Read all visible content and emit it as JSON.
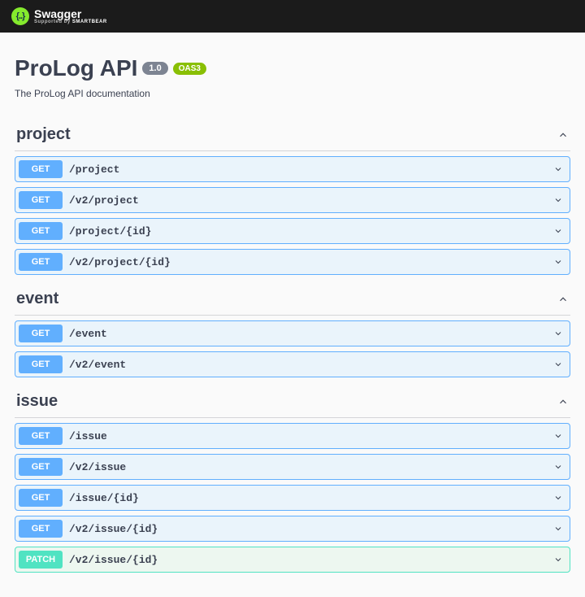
{
  "topbar": {
    "brand": "Swagger",
    "supported_prefix": "Supported by",
    "supported_name": "SMARTBEAR",
    "logo_glyph": "{..}"
  },
  "info": {
    "title": "ProLog API",
    "version": "1.0",
    "oas_badge": "OAS3",
    "description": "The ProLog API documentation"
  },
  "colors": {
    "get": "#61affe",
    "patch": "#50e3c2",
    "oas": "#89bf04"
  },
  "tags": [
    {
      "name": "project",
      "operations": [
        {
          "method": "GET",
          "method_class": "get",
          "path": "/project"
        },
        {
          "method": "GET",
          "method_class": "get",
          "path": "/v2/project"
        },
        {
          "method": "GET",
          "method_class": "get",
          "path": "/project/{id}"
        },
        {
          "method": "GET",
          "method_class": "get",
          "path": "/v2/project/{id}"
        }
      ]
    },
    {
      "name": "event",
      "operations": [
        {
          "method": "GET",
          "method_class": "get",
          "path": "/event"
        },
        {
          "method": "GET",
          "method_class": "get",
          "path": "/v2/event"
        }
      ]
    },
    {
      "name": "issue",
      "operations": [
        {
          "method": "GET",
          "method_class": "get",
          "path": "/issue"
        },
        {
          "method": "GET",
          "method_class": "get",
          "path": "/v2/issue"
        },
        {
          "method": "GET",
          "method_class": "get",
          "path": "/issue/{id}"
        },
        {
          "method": "GET",
          "method_class": "get",
          "path": "/v2/issue/{id}"
        },
        {
          "method": "PATCH",
          "method_class": "patch",
          "path": "/v2/issue/{id}"
        }
      ]
    }
  ]
}
